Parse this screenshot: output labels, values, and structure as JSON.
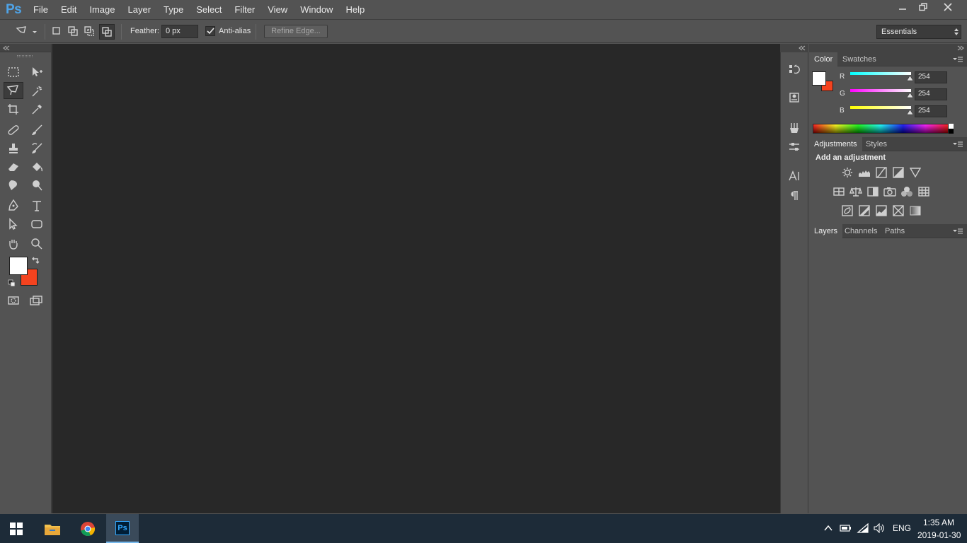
{
  "app": {
    "logo": "Ps"
  },
  "menu": [
    "File",
    "Edit",
    "Image",
    "Layer",
    "Type",
    "Select",
    "Filter",
    "View",
    "Window",
    "Help"
  ],
  "options": {
    "feather_label": "Feather:",
    "feather_value": "0 px",
    "antialias_label": "Anti-alias",
    "antialias_checked": true,
    "refine_edge_label": "Refine Edge...",
    "workspace": "Essentials"
  },
  "colors": {
    "foreground": "#ffffff",
    "background": "#f4431f",
    "accent": "#4fa4e8"
  },
  "color_panel": {
    "tabs": [
      "Color",
      "Swatches"
    ],
    "channels": [
      {
        "label": "R",
        "value": "254"
      },
      {
        "label": "G",
        "value": "254"
      },
      {
        "label": "B",
        "value": "254"
      }
    ]
  },
  "adjustments_panel": {
    "tabs": [
      "Adjustments",
      "Styles"
    ],
    "heading": "Add an adjustment"
  },
  "layers_panel": {
    "tabs": [
      "Layers",
      "Channels",
      "Paths"
    ]
  },
  "taskbar": {
    "language": "ENG",
    "time": "1:35 AM",
    "date": "2019-01-30",
    "ps_label": "Ps"
  }
}
